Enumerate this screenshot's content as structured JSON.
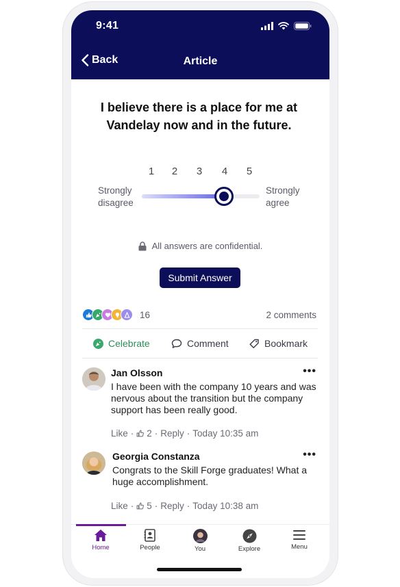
{
  "status_bar": {
    "time": "9:41"
  },
  "header": {
    "back_label": "Back",
    "title": "Article"
  },
  "question": {
    "text": "I believe there is a place for me at Vandelay now and in the future."
  },
  "scale": {
    "numbers": [
      "1",
      "2",
      "3",
      "4",
      "5"
    ],
    "selected_value": 4,
    "min_value": 1,
    "max_value": 5,
    "left_anchor": [
      "Strongly",
      "disagree"
    ],
    "right_anchor": [
      "Strongly",
      "agree"
    ]
  },
  "confidential_note": "All answers are confidential.",
  "submit_label": "Submit Answer",
  "reactions": {
    "icons": [
      "like-icon",
      "celebrate-icon",
      "support-icon",
      "insightful-icon",
      "curious-icon"
    ],
    "colors": [
      "#1d7ad9",
      "#3aa86b",
      "#c77de0",
      "#f2b636",
      "#9a8cf0"
    ],
    "count": "16"
  },
  "comments_count": "2 comments",
  "actions": {
    "celebrate": "Celebrate",
    "comment": "Comment",
    "bookmark": "Bookmark"
  },
  "comments": [
    {
      "author": "Jan Olsson",
      "lines": [
        "I have been with the company 10 years and was",
        "nervous about the transition but the company",
        "support has been really good."
      ],
      "like_label": "Like",
      "like_count": "2",
      "reply_label": "Reply",
      "timestamp": "Today 10:35 am"
    },
    {
      "author": "Georgia Constanza",
      "lines": [
        "Congrats to the Skill Forge graduates! What a",
        "huge accomplishment."
      ],
      "like_label": "Like",
      "like_count": "5",
      "reply_label": "Reply",
      "timestamp": "Today 10:38 am"
    }
  ],
  "nav": {
    "items": [
      {
        "label": "Home",
        "icon": "home-icon",
        "active": true
      },
      {
        "label": "People",
        "icon": "people-icon"
      },
      {
        "label": "You",
        "icon": "avatar-icon"
      },
      {
        "label": "Explore",
        "icon": "compass-icon"
      },
      {
        "label": "Menu",
        "icon": "hamburger-icon"
      }
    ]
  },
  "colors": {
    "brand_navy": "#0c0e5a",
    "nav_active": "#6a1b9a",
    "celebrate_green": "#2e8b57"
  }
}
